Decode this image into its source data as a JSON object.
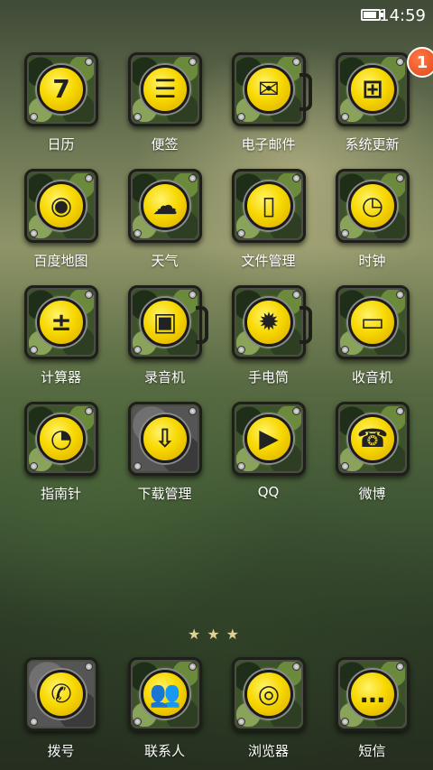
{
  "status_bar": {
    "time": "14:59",
    "battery_level": 0.9
  },
  "apps": [
    {
      "id": "calendar",
      "label": "日历",
      "icon": "calendar-icon",
      "glyph": "7",
      "style": "camo"
    },
    {
      "id": "notes",
      "label": "便签",
      "icon": "notes-icon",
      "glyph": "☰",
      "style": "camo"
    },
    {
      "id": "email",
      "label": "电子邮件",
      "icon": "envelope-icon",
      "glyph": "✉",
      "style": "mug"
    },
    {
      "id": "system-update",
      "label": "系统更新",
      "icon": "windows-icon",
      "glyph": "⊞",
      "style": "camo",
      "badge": "1"
    },
    {
      "id": "baidu-map",
      "label": "百度地图",
      "icon": "map-pin-icon",
      "glyph": "◉",
      "style": "camo"
    },
    {
      "id": "weather",
      "label": "天气",
      "icon": "cloud-rain-icon",
      "glyph": "☁",
      "style": "camo"
    },
    {
      "id": "file-manager",
      "label": "文件管理",
      "icon": "document-icon",
      "glyph": "▯",
      "style": "camo"
    },
    {
      "id": "clock",
      "label": "时钟",
      "icon": "alarm-clock-icon",
      "glyph": "◷",
      "style": "camo"
    },
    {
      "id": "calculator",
      "label": "计算器",
      "icon": "calculator-icon",
      "glyph": "±",
      "style": "camo"
    },
    {
      "id": "recorder",
      "label": "录音机",
      "icon": "recorder-icon",
      "glyph": "▣",
      "style": "mug"
    },
    {
      "id": "flashlight",
      "label": "手电筒",
      "icon": "flashlight-icon",
      "glyph": "✹",
      "style": "mug"
    },
    {
      "id": "radio",
      "label": "收音机",
      "icon": "tv-icon",
      "glyph": "▭",
      "style": "camo"
    },
    {
      "id": "compass",
      "label": "指南针",
      "icon": "stopwatch-icon",
      "glyph": "◔",
      "style": "camo"
    },
    {
      "id": "download-manager",
      "label": "下载管理",
      "icon": "download-tray-icon",
      "glyph": "⇩",
      "style": "gray"
    },
    {
      "id": "qq",
      "label": "QQ",
      "icon": "play-icon",
      "glyph": "▶",
      "style": "camo"
    },
    {
      "id": "weibo",
      "label": "微博",
      "icon": "telephone-icon",
      "glyph": "☎",
      "style": "camo"
    }
  ],
  "pager": {
    "glyph": "★★★",
    "current_page": 2,
    "total_pages": 3
  },
  "dock": [
    {
      "id": "dialer",
      "label": "拨号",
      "icon": "phone-handset-icon",
      "glyph": "✆",
      "style": "gray"
    },
    {
      "id": "contacts",
      "label": "联系人",
      "icon": "contacts-icon",
      "glyph": "👥",
      "style": "camo"
    },
    {
      "id": "browser",
      "label": "浏览器",
      "icon": "browser-icon",
      "glyph": "◎",
      "style": "camo"
    },
    {
      "id": "messages",
      "label": "短信",
      "icon": "message-bubble-icon",
      "glyph": "…",
      "style": "camo"
    }
  ]
}
